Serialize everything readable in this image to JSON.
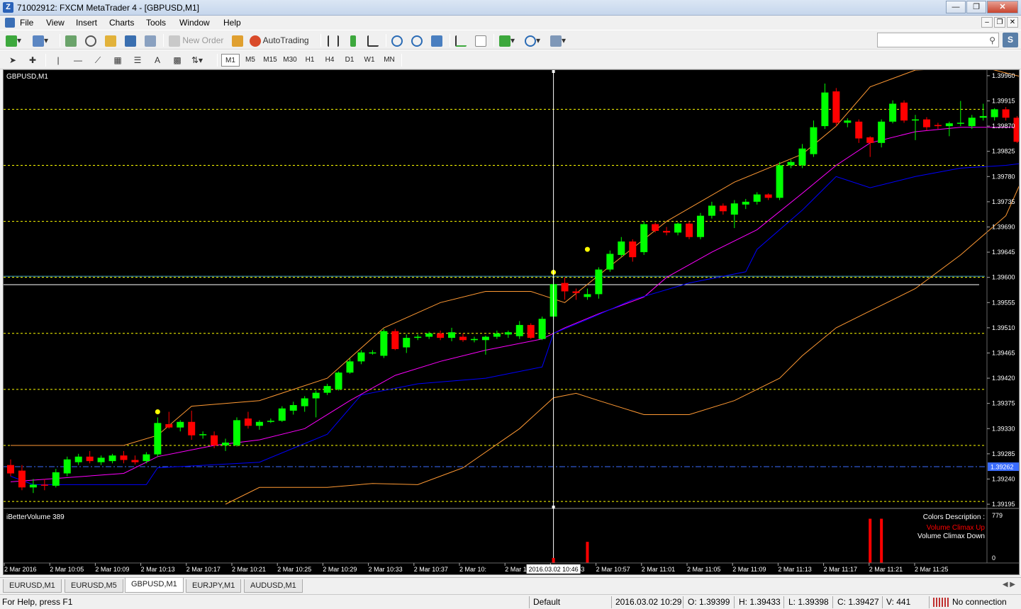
{
  "window": {
    "title": "71002912: FXCM MetaTrader 4 - [GBPUSD,M1]"
  },
  "menu": [
    "File",
    "View",
    "Insert",
    "Charts",
    "Tools",
    "Window",
    "Help"
  ],
  "toolbar": {
    "new_order_label": "New Order",
    "autotrading_label": "AutoTrading"
  },
  "timeframes": [
    "M1",
    "M5",
    "M15",
    "M30",
    "H1",
    "H4",
    "D1",
    "W1",
    "MN"
  ],
  "active_timeframe": "M1",
  "search": {
    "placeholder": ""
  },
  "chart": {
    "symbol_label": "GBPUSD,M1",
    "indicator_label": "iBetterVolume 389",
    "volume_axis_label": "779",
    "volume_axis_zero": "0",
    "colors_title": "Colors Description :",
    "legend_up": "Volume Climax Up",
    "legend_down": "Volume Climax Down",
    "crosshair_time": "2016.03.02 10:46",
    "current_price_label": "1.39262",
    "colors": {
      "bull": "#00ff00",
      "bear": "#ff0000",
      "bb_outer": "#ff9933",
      "bb_mid": "#ff00ff",
      "lower_channel": "#0000ff",
      "grid_level": "#ffff00",
      "crosshair": "#ffffff",
      "current_price": "#3a6cff",
      "hline": "#ffffff",
      "vol_bar": "#ff0000"
    }
  },
  "chart_data": {
    "type": "candlestick",
    "symbol": "GBPUSD",
    "timeframe": "M1",
    "ylim": [
      1.3919,
      1.3997
    ],
    "y_ticks": [
      "1.39960",
      "1.39915",
      "1.39870",
      "1.39825",
      "1.39780",
      "1.39735",
      "1.39690",
      "1.39645",
      "1.39600",
      "1.39555",
      "1.39510",
      "1.39465",
      "1.39420",
      "1.39375",
      "1.39330",
      "1.39285",
      "1.39240",
      "1.39195"
    ],
    "x_ticks": [
      "2 Mar 2016",
      "2 Mar 10:05",
      "2 Mar 10:09",
      "2 Mar 10:13",
      "2 Mar 10:17",
      "2 Mar 10:21",
      "2 Mar 10:25",
      "2 Mar 10:29",
      "2 Mar 10:33",
      "2 Mar 10:37",
      "2 Mar 10:",
      "2 Mar 10:49",
      "2 Mar 10:53",
      "2 Mar 10:57",
      "2 Mar 11:01",
      "2 Mar 11:05",
      "2 Mar 11:09",
      "2 Mar 11:13",
      "2 Mar 11:17",
      "2 Mar 11:21",
      "2 Mar 11:25"
    ],
    "yellow_levels": [
      1.399,
      1.398,
      1.397,
      1.396,
      1.395,
      1.394,
      1.393,
      1.392
    ],
    "white_hline": 1.39587,
    "cyan_hline": 1.39602,
    "current_price": 1.39262,
    "candles": [
      {
        "o": 1.39265,
        "h": 1.39275,
        "l": 1.39245,
        "c": 1.3925
      },
      {
        "o": 1.39255,
        "h": 1.39265,
        "l": 1.3922,
        "c": 1.39225
      },
      {
        "o": 1.39225,
        "h": 1.3924,
        "l": 1.39215,
        "c": 1.3923
      },
      {
        "o": 1.3923,
        "h": 1.3924,
        "l": 1.3922,
        "c": 1.39228
      },
      {
        "o": 1.39228,
        "h": 1.39258,
        "l": 1.39225,
        "c": 1.39252
      },
      {
        "o": 1.3925,
        "h": 1.3928,
        "l": 1.39245,
        "c": 1.39275
      },
      {
        "o": 1.3927,
        "h": 1.39285,
        "l": 1.39265,
        "c": 1.3928
      },
      {
        "o": 1.3928,
        "h": 1.3929,
        "l": 1.39268,
        "c": 1.39272
      },
      {
        "o": 1.3927,
        "h": 1.39282,
        "l": 1.39265,
        "c": 1.39278
      },
      {
        "o": 1.39272,
        "h": 1.39285,
        "l": 1.39268,
        "c": 1.39282
      },
      {
        "o": 1.39282,
        "h": 1.3929,
        "l": 1.39268,
        "c": 1.39274
      },
      {
        "o": 1.39274,
        "h": 1.39282,
        "l": 1.39266,
        "c": 1.3927
      },
      {
        "o": 1.39272,
        "h": 1.39288,
        "l": 1.39268,
        "c": 1.39284
      },
      {
        "o": 1.39284,
        "h": 1.3935,
        "l": 1.3928,
        "c": 1.3934
      },
      {
        "o": 1.39338,
        "h": 1.3936,
        "l": 1.3933,
        "c": 1.39332
      },
      {
        "o": 1.39332,
        "h": 1.39345,
        "l": 1.39325,
        "c": 1.39342
      },
      {
        "o": 1.39342,
        "h": 1.39362,
        "l": 1.3931,
        "c": 1.39318
      },
      {
        "o": 1.3932,
        "h": 1.39325,
        "l": 1.39312,
        "c": 1.3932
      },
      {
        "o": 1.39318,
        "h": 1.39325,
        "l": 1.39295,
        "c": 1.393
      },
      {
        "o": 1.393,
        "h": 1.39312,
        "l": 1.3929,
        "c": 1.39305
      },
      {
        "o": 1.393,
        "h": 1.3935,
        "l": 1.39298,
        "c": 1.39345
      },
      {
        "o": 1.39348,
        "h": 1.3936,
        "l": 1.3933,
        "c": 1.39335
      },
      {
        "o": 1.39335,
        "h": 1.39345,
        "l": 1.39328,
        "c": 1.39342
      },
      {
        "o": 1.39342,
        "h": 1.39348,
        "l": 1.3934,
        "c": 1.39344
      },
      {
        "o": 1.39344,
        "h": 1.3937,
        "l": 1.39342,
        "c": 1.39366
      },
      {
        "o": 1.39362,
        "h": 1.39378,
        "l": 1.39355,
        "c": 1.39372
      },
      {
        "o": 1.3937,
        "h": 1.39388,
        "l": 1.3936,
        "c": 1.39384
      },
      {
        "o": 1.39384,
        "h": 1.39398,
        "l": 1.3935,
        "c": 1.39394
      },
      {
        "o": 1.39394,
        "h": 1.3941,
        "l": 1.3939,
        "c": 1.39406
      },
      {
        "o": 1.394,
        "h": 1.39432,
        "l": 1.39398,
        "c": 1.3943
      },
      {
        "o": 1.3943,
        "h": 1.39455,
        "l": 1.39428,
        "c": 1.3945
      },
      {
        "o": 1.3945,
        "h": 1.3947,
        "l": 1.39445,
        "c": 1.39466
      },
      {
        "o": 1.39465,
        "h": 1.3947,
        "l": 1.39462,
        "c": 1.39466
      },
      {
        "o": 1.3946,
        "h": 1.39508,
        "l": 1.39456,
        "c": 1.39504
      },
      {
        "o": 1.39504,
        "h": 1.39508,
        "l": 1.3947,
        "c": 1.39472
      },
      {
        "o": 1.39475,
        "h": 1.39498,
        "l": 1.39465,
        "c": 1.39492
      },
      {
        "o": 1.39492,
        "h": 1.39498,
        "l": 1.39488,
        "c": 1.39494
      },
      {
        "o": 1.39494,
        "h": 1.39503,
        "l": 1.3949,
        "c": 1.395
      },
      {
        "o": 1.395,
        "h": 1.39505,
        "l": 1.39488,
        "c": 1.39492
      },
      {
        "o": 1.39492,
        "h": 1.3951,
        "l": 1.39486,
        "c": 1.39502
      },
      {
        "o": 1.39494,
        "h": 1.395,
        "l": 1.39485,
        "c": 1.39488
      },
      {
        "o": 1.39488,
        "h": 1.39494,
        "l": 1.39484,
        "c": 1.3949
      },
      {
        "o": 1.39488,
        "h": 1.39496,
        "l": 1.39462,
        "c": 1.39494
      },
      {
        "o": 1.39494,
        "h": 1.39505,
        "l": 1.3949,
        "c": 1.395
      },
      {
        "o": 1.39498,
        "h": 1.39505,
        "l": 1.39492,
        "c": 1.39502
      },
      {
        "o": 1.39495,
        "h": 1.39522,
        "l": 1.3949,
        "c": 1.39515
      },
      {
        "o": 1.39515,
        "h": 1.39518,
        "l": 1.3949,
        "c": 1.39492
      },
      {
        "o": 1.3949,
        "h": 1.3953,
        "l": 1.39488,
        "c": 1.39526
      },
      {
        "o": 1.3953,
        "h": 1.39598,
        "l": 1.39525,
        "c": 1.39588
      },
      {
        "o": 1.3959,
        "h": 1.396,
        "l": 1.3956,
        "c": 1.39575
      },
      {
        "o": 1.39575,
        "h": 1.3958,
        "l": 1.3956,
        "c": 1.39572
      },
      {
        "o": 1.39565,
        "h": 1.3958,
        "l": 1.3956,
        "c": 1.3957
      },
      {
        "o": 1.3957,
        "h": 1.39618,
        "l": 1.39562,
        "c": 1.39614
      },
      {
        "o": 1.39614,
        "h": 1.39648,
        "l": 1.3961,
        "c": 1.39642
      },
      {
        "o": 1.3964,
        "h": 1.39672,
        "l": 1.39636,
        "c": 1.39664
      },
      {
        "o": 1.39664,
        "h": 1.39668,
        "l": 1.39628,
        "c": 1.39636
      },
      {
        "o": 1.39645,
        "h": 1.397,
        "l": 1.3964,
        "c": 1.39695
      },
      {
        "o": 1.39695,
        "h": 1.39698,
        "l": 1.3968,
        "c": 1.39683
      },
      {
        "o": 1.39683,
        "h": 1.3969,
        "l": 1.39675,
        "c": 1.3968
      },
      {
        "o": 1.3968,
        "h": 1.39698,
        "l": 1.39675,
        "c": 1.39696
      },
      {
        "o": 1.39696,
        "h": 1.397,
        "l": 1.39668,
        "c": 1.39672
      },
      {
        "o": 1.39672,
        "h": 1.39715,
        "l": 1.39668,
        "c": 1.3971
      },
      {
        "o": 1.3971,
        "h": 1.39735,
        "l": 1.39705,
        "c": 1.39728
      },
      {
        "o": 1.39728,
        "h": 1.39732,
        "l": 1.39712,
        "c": 1.39718
      },
      {
        "o": 1.39712,
        "h": 1.39738,
        "l": 1.39688,
        "c": 1.39732
      },
      {
        "o": 1.3973,
        "h": 1.3974,
        "l": 1.39722,
        "c": 1.39735
      },
      {
        "o": 1.39735,
        "h": 1.39752,
        "l": 1.3973,
        "c": 1.39748
      },
      {
        "o": 1.39748,
        "h": 1.3975,
        "l": 1.39738,
        "c": 1.39742
      },
      {
        "o": 1.39742,
        "h": 1.39806,
        "l": 1.39738,
        "c": 1.398
      },
      {
        "o": 1.398,
        "h": 1.3981,
        "l": 1.39795,
        "c": 1.39806
      },
      {
        "o": 1.398,
        "h": 1.39838,
        "l": 1.39795,
        "c": 1.3983
      },
      {
        "o": 1.3982,
        "h": 1.3988,
        "l": 1.39815,
        "c": 1.39868
      },
      {
        "o": 1.3987,
        "h": 1.39946,
        "l": 1.39865,
        "c": 1.3993
      },
      {
        "o": 1.39932,
        "h": 1.39938,
        "l": 1.3987,
        "c": 1.39876
      },
      {
        "o": 1.39876,
        "h": 1.39884,
        "l": 1.39868,
        "c": 1.3988
      },
      {
        "o": 1.39878,
        "h": 1.39882,
        "l": 1.3984,
        "c": 1.39848
      },
      {
        "o": 1.3985,
        "h": 1.39852,
        "l": 1.39815,
        "c": 1.3984
      },
      {
        "o": 1.3984,
        "h": 1.39882,
        "l": 1.39832,
        "c": 1.39878
      },
      {
        "o": 1.39878,
        "h": 1.39916,
        "l": 1.39875,
        "c": 1.3991
      },
      {
        "o": 1.39912,
        "h": 1.39916,
        "l": 1.39876,
        "c": 1.3988
      },
      {
        "o": 1.3988,
        "h": 1.3989,
        "l": 1.39845,
        "c": 1.39882
      },
      {
        "o": 1.39882,
        "h": 1.39886,
        "l": 1.39862,
        "c": 1.39868
      },
      {
        "o": 1.39872,
        "h": 1.39876,
        "l": 1.39865,
        "c": 1.3987
      },
      {
        "o": 1.3987,
        "h": 1.39878,
        "l": 1.39852,
        "c": 1.39875
      },
      {
        "o": 1.39875,
        "h": 1.39915,
        "l": 1.3987,
        "c": 1.39876
      },
      {
        "o": 1.3987,
        "h": 1.3989,
        "l": 1.39865,
        "c": 1.39885
      },
      {
        "o": 1.39885,
        "h": 1.3991,
        "l": 1.3988,
        "c": 1.39888
      },
      {
        "o": 1.39886,
        "h": 1.39902,
        "l": 1.3988,
        "c": 1.399
      },
      {
        "o": 1.399,
        "h": 1.39904,
        "l": 1.3988,
        "c": 1.39885
      },
      {
        "o": 1.39885,
        "h": 1.39888,
        "l": 1.3984,
        "c": 1.39842
      },
      {
        "o": 1.39842,
        "h": 1.39848,
        "l": 1.39832,
        "c": 1.39845
      },
      {
        "o": 1.3984,
        "h": 1.39876,
        "l": 1.39836,
        "c": 1.39868
      },
      {
        "o": 1.39868,
        "h": 1.3987,
        "l": 1.39845,
        "c": 1.39848
      }
    ],
    "bb_upper": [
      [
        0,
        1.393
      ],
      [
        10,
        1.393
      ],
      [
        13,
        1.39318
      ],
      [
        16,
        1.3937
      ],
      [
        22,
        1.3938
      ],
      [
        28,
        1.3942
      ],
      [
        33,
        1.3951
      ],
      [
        38,
        1.39555
      ],
      [
        42,
        1.39575
      ],
      [
        46,
        1.39575
      ],
      [
        49,
        1.39555
      ],
      [
        53,
        1.3962
      ],
      [
        58,
        1.397
      ],
      [
        64,
        1.3977
      ],
      [
        70,
        1.3982
      ],
      [
        73,
        1.3987
      ],
      [
        76,
        1.3994
      ],
      [
        80,
        1.3997
      ],
      [
        86,
        1.39975
      ],
      [
        90,
        1.39955
      ],
      [
        92,
        1.3994
      ]
    ],
    "bb_lower": [
      [
        19,
        1.39195
      ],
      [
        22,
        1.39225
      ],
      [
        28,
        1.39225
      ],
      [
        32,
        1.39232
      ],
      [
        36,
        1.3923
      ],
      [
        40,
        1.3926
      ],
      [
        45,
        1.3933
      ],
      [
        48,
        1.39385
      ],
      [
        50,
        1.39393
      ],
      [
        52,
        1.3938
      ],
      [
        56,
        1.39355
      ],
      [
        60,
        1.39355
      ],
      [
        64,
        1.3938
      ],
      [
        68,
        1.3942
      ],
      [
        70,
        1.3946
      ],
      [
        73,
        1.3951
      ],
      [
        76,
        1.3954
      ],
      [
        80,
        1.3958
      ],
      [
        84,
        1.3964
      ],
      [
        88,
        1.3971
      ],
      [
        90,
        1.398
      ],
      [
        92,
        1.3982
      ]
    ],
    "bb_mid": [
      [
        0,
        1.39235
      ],
      [
        10,
        1.3925
      ],
      [
        13,
        1.3928
      ],
      [
        18,
        1.393
      ],
      [
        22,
        1.3931
      ],
      [
        26,
        1.3933
      ],
      [
        30,
        1.3938
      ],
      [
        34,
        1.39425
      ],
      [
        38,
        1.3945
      ],
      [
        42,
        1.3947
      ],
      [
        47,
        1.3949
      ],
      [
        49,
        1.3951
      ],
      [
        52,
        1.39535
      ],
      [
        56,
        1.39565
      ],
      [
        58,
        1.396
      ],
      [
        62,
        1.39645
      ],
      [
        66,
        1.39685
      ],
      [
        70,
        1.3975
      ],
      [
        73,
        1.398
      ],
      [
        76,
        1.3984
      ],
      [
        80,
        1.3986
      ],
      [
        84,
        1.39868
      ],
      [
        88,
        1.39868
      ],
      [
        90,
        1.39868
      ],
      [
        92,
        1.39862
      ]
    ],
    "lower_channel": [
      [
        0,
        1.39245
      ],
      [
        2,
        1.3923
      ],
      [
        12,
        1.3923
      ],
      [
        13,
        1.3926
      ],
      [
        22,
        1.3927
      ],
      [
        28,
        1.3932
      ],
      [
        31,
        1.3939
      ],
      [
        36,
        1.3941
      ],
      [
        42,
        1.3942
      ],
      [
        47,
        1.3944
      ],
      [
        48,
        1.395
      ],
      [
        51,
        1.39525
      ],
      [
        55,
        1.3956
      ],
      [
        60,
        1.3959
      ],
      [
        65,
        1.3961
      ],
      [
        66,
        1.3965
      ],
      [
        70,
        1.3972
      ],
      [
        73,
        1.3978
      ],
      [
        76,
        1.3976
      ],
      [
        80,
        1.3978
      ],
      [
        84,
        1.39795
      ],
      [
        88,
        1.398
      ],
      [
        92,
        1.3981
      ]
    ],
    "yellow_dots": [
      [
        13,
        1.3936
      ],
      [
        48,
        1.39609
      ],
      [
        51,
        1.3965
      ]
    ],
    "volume_climax_bars": [
      [
        48,
        0.1
      ],
      [
        51,
        0.42
      ],
      [
        76,
        0.88
      ],
      [
        77,
        0.88
      ]
    ],
    "crosshair_index": 48
  },
  "tabs": [
    "EURUSD,M1",
    "EURUSD,M5",
    "GBPUSD,M1",
    "EURJPY,M1",
    "AUDUSD,M1"
  ],
  "active_tab": "GBPUSD,M1",
  "status": {
    "help": "For Help, press F1",
    "profile": "Default",
    "datetime": "2016.03.02 10:29",
    "open": "O: 1.39399",
    "high": "H: 1.39433",
    "low": "L: 1.39398",
    "close": "C: 1.39427",
    "volume": "V: 441",
    "connection": "No connection"
  }
}
